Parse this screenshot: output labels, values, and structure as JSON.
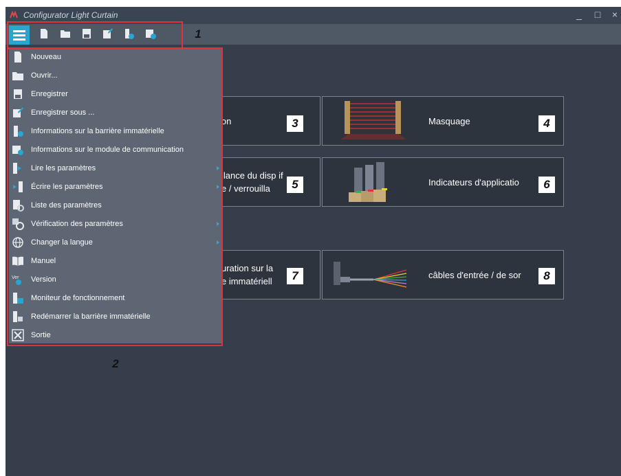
{
  "window": {
    "title": "Configurator Light Curtain",
    "minimize": "_",
    "maximize": "□",
    "close": "×"
  },
  "callouts": [
    "1",
    "2",
    "3",
    "4",
    "5",
    "6",
    "7",
    "8"
  ],
  "menu": [
    {
      "label": "Nouveau",
      "icon": "new-file-icon",
      "submenu": false
    },
    {
      "label": "Ouvrir...",
      "icon": "folder-icon",
      "submenu": false
    },
    {
      "label": "Enregistrer",
      "icon": "save-icon",
      "submenu": false
    },
    {
      "label": "Enregistrer sous ...",
      "icon": "save-as-icon",
      "submenu": false
    },
    {
      "label": "Informations sur la barrière immatérielle",
      "icon": "light-curtain-info-icon",
      "submenu": false
    },
    {
      "label": "Informations sur le module de communication",
      "icon": "comm-module-info-icon",
      "submenu": false
    },
    {
      "label": "Lire les paramètres",
      "icon": "read-params-icon",
      "submenu": true
    },
    {
      "label": "Écrire les paramètres",
      "icon": "write-params-icon",
      "submenu": true
    },
    {
      "label": "Liste des paramètres",
      "icon": "param-list-icon",
      "submenu": false
    },
    {
      "label": "Vérification des paramètres",
      "icon": "param-check-icon",
      "submenu": true
    },
    {
      "label": "Changer la langue",
      "icon": "globe-icon",
      "submenu": true
    },
    {
      "label": "Manuel",
      "icon": "book-icon",
      "submenu": false
    },
    {
      "label": "Version",
      "icon": "version-icon",
      "submenu": false
    },
    {
      "label": "Moniteur de fonctionnement",
      "icon": "monitor-icon",
      "submenu": false
    },
    {
      "label": "Redémarrer la barrière immatérielle",
      "icon": "restart-icon",
      "submenu": false
    },
    {
      "label": "Sortie",
      "icon": "exit-icon",
      "submenu": false
    }
  ],
  "cards": {
    "c3": {
      "line1": "ion"
    },
    "c4": {
      "line1": "Masquage"
    },
    "c5": {
      "line1": "llance du disp   if",
      "line2": "e  / verrouilla"
    },
    "c6": {
      "line1": "Indicateurs d'applicatio"
    },
    "c7": {
      "line1": "uration sur la",
      "line2": "e immatériell"
    },
    "c8": {
      "line1": "câbles d'entrée / de sor"
    }
  },
  "colors": {
    "accent": "#26a7d2",
    "highlight": "#e0323a",
    "background": "#363e4c"
  }
}
